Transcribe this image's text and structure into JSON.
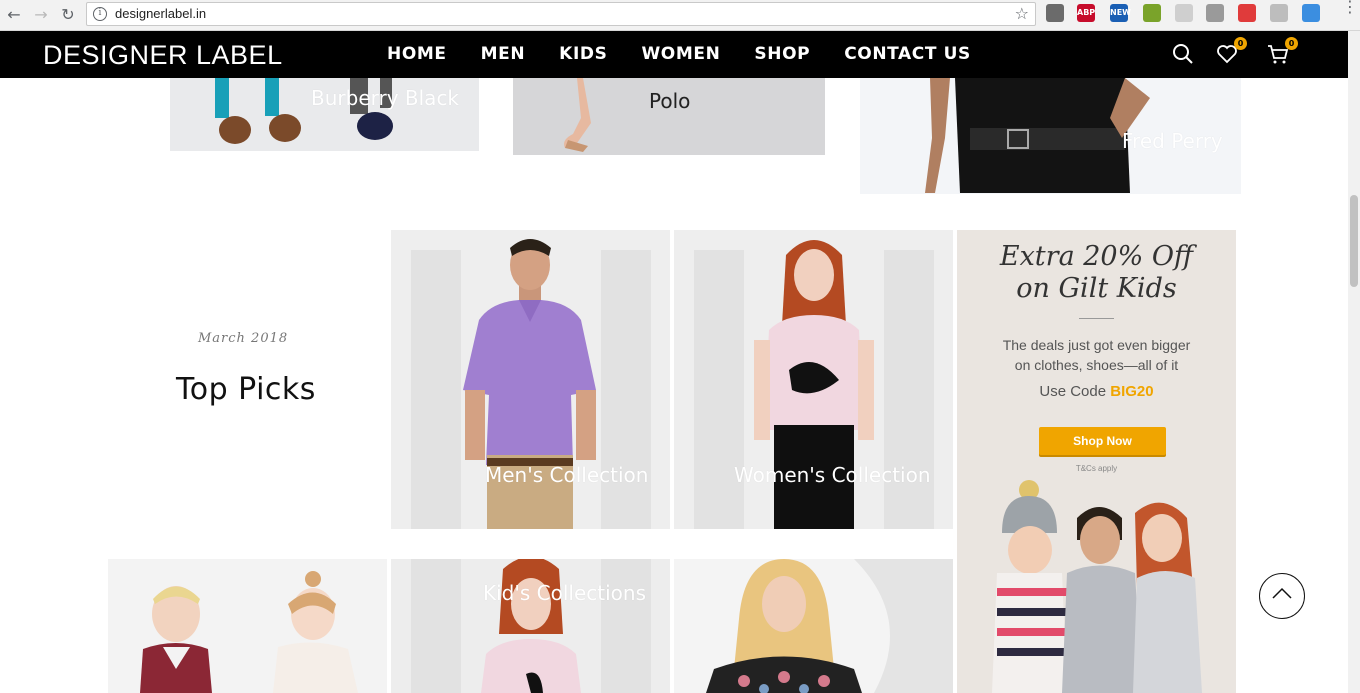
{
  "browser": {
    "url": "designerlabel.in",
    "extensions": [
      {
        "name": "eyedropper-ext-icon",
        "label": "",
        "color": "#6b6b6b"
      },
      {
        "name": "adblock-plus-icon",
        "label": "ABP",
        "color": "#c70d2c"
      },
      {
        "name": "news-ext-icon",
        "label": "NEW",
        "color": "#1a5fb4"
      },
      {
        "name": "green-ext-icon",
        "label": "",
        "color": "#7aa32a"
      },
      {
        "name": "circle-ext-icon",
        "label": "",
        "color": "#cfcfcf"
      },
      {
        "name": "bow-ext-icon",
        "label": "",
        "color": "#9a9a9a"
      },
      {
        "name": "red-ext-icon",
        "label": "",
        "color": "#e03b3b"
      },
      {
        "name": "hex-ext-icon",
        "label": "",
        "color": "#bdbdbd"
      },
      {
        "name": "blue-dots-ext-icon",
        "label": "",
        "color": "#3b8ee0"
      }
    ]
  },
  "header": {
    "logo": "DESIGNER LABEL",
    "nav": [
      {
        "label": "HOME"
      },
      {
        "label": "MEN"
      },
      {
        "label": "KIDS"
      },
      {
        "label": "WOMEN"
      },
      {
        "label": "SHOP"
      },
      {
        "label": "CONTACT US"
      }
    ],
    "wishlist_count": "0",
    "cart_count": "0"
  },
  "brands": [
    {
      "label": "Burberry Black"
    },
    {
      "label": "Polo"
    },
    {
      "label": "Fred Perry"
    }
  ],
  "section": {
    "date": "March 2018",
    "title": "Top Picks"
  },
  "collections": [
    {
      "label": "Men's Collection"
    },
    {
      "label": "Women's Collection"
    },
    {
      "label": "Kid's Collections"
    }
  ],
  "promo": {
    "title_line1": "Extra 20% Off",
    "title_line2": "on Gilt Kids",
    "text_line1": "The deals just got even bigger",
    "text_line2": "on clothes, shoes—all of it",
    "code_prefix": "Use Code",
    "code": "BIG20",
    "button": "Shop Now",
    "terms": "T&Cs apply"
  },
  "colors": {
    "accent": "#f0a500",
    "header_bg": "#000000"
  }
}
